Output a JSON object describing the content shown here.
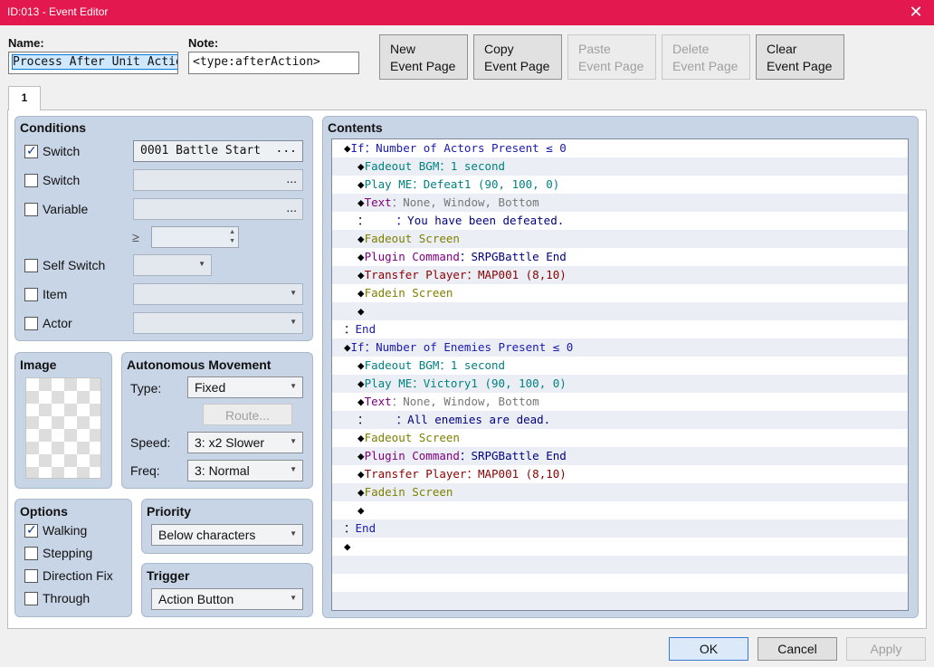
{
  "window": {
    "title": "ID:013 - Event Editor",
    "close_glyph": "✕"
  },
  "header": {
    "name_label": "Name:",
    "name_value": "Process After Unit Action",
    "note_label": "Note:",
    "note_value": "<type:afterAction>",
    "buttons": [
      {
        "line1": "New",
        "line2": "Event Page",
        "enabled": true
      },
      {
        "line1": "Copy",
        "line2": "Event Page",
        "enabled": true
      },
      {
        "line1": "Paste",
        "line2": "Event Page",
        "enabled": false
      },
      {
        "line1": "Delete",
        "line2": "Event Page",
        "enabled": false
      },
      {
        "line1": "Clear",
        "line2": "Event Page",
        "enabled": true
      }
    ]
  },
  "tabs": [
    {
      "label": "1"
    }
  ],
  "conditions": {
    "title": "Conditions",
    "switch1": {
      "label": "Switch",
      "checked": true,
      "value": "0001 Battle Start",
      "dots": "..."
    },
    "switch2": {
      "label": "Switch",
      "checked": false,
      "value": "",
      "dots": "..."
    },
    "variable": {
      "label": "Variable",
      "checked": false,
      "value": "",
      "dots": "...",
      "op": "≥",
      "amount": ""
    },
    "self_switch": {
      "label": "Self Switch",
      "checked": false,
      "value": ""
    },
    "item": {
      "label": "Item",
      "checked": false,
      "value": ""
    },
    "actor": {
      "label": "Actor",
      "checked": false,
      "value": ""
    }
  },
  "image": {
    "title": "Image"
  },
  "autonomous": {
    "title": "Autonomous Movement",
    "type_label": "Type:",
    "type_value": "Fixed",
    "route_button": "Route...",
    "speed_label": "Speed:",
    "speed_value": "3: x2 Slower",
    "freq_label": "Freq:",
    "freq_value": "3: Normal"
  },
  "options": {
    "title": "Options",
    "items": [
      {
        "label": "Walking",
        "checked": true
      },
      {
        "label": "Stepping",
        "checked": false
      },
      {
        "label": "Direction Fix",
        "checked": false
      },
      {
        "label": "Through",
        "checked": false
      }
    ]
  },
  "priority": {
    "title": "Priority",
    "value": "Below characters"
  },
  "trigger": {
    "title": "Trigger",
    "value": "Action Button"
  },
  "contents": {
    "title": "Contents",
    "lines": [
      [
        [
          "◆",
          "black"
        ],
        [
          "If",
          "blue"
        ],
        [
          "：Number of Actors Present ≤ 0",
          "blue"
        ]
      ],
      [
        [
          "  ◆",
          "black"
        ],
        [
          "Fadeout BGM：1 second",
          "teal"
        ]
      ],
      [
        [
          "  ◆",
          "black"
        ],
        [
          "Play ME：Defeat1 (90, 100, 0)",
          "teal"
        ]
      ],
      [
        [
          "  ◆",
          "black"
        ],
        [
          "Text",
          "purple"
        ],
        [
          "：None, Window, Bottom",
          "gray"
        ]
      ],
      [
        [
          "  ：",
          "black"
        ],
        [
          "    ：You have been defeated.",
          "navy"
        ]
      ],
      [
        [
          "  ◆",
          "black"
        ],
        [
          "Fadeout Screen",
          "olive"
        ]
      ],
      [
        [
          "  ◆",
          "black"
        ],
        [
          "Plugin Command",
          "purple"
        ],
        [
          "：SRPGBattle End",
          "navy"
        ]
      ],
      [
        [
          "  ◆",
          "black"
        ],
        [
          "Transfer Player：MAP001 (8,10)",
          "maroon"
        ]
      ],
      [
        [
          "  ◆",
          "black"
        ],
        [
          "Fadein Screen",
          "olive"
        ]
      ],
      [
        [
          "  ◆",
          "black"
        ]
      ],
      [
        [
          "：",
          "black"
        ],
        [
          "End",
          "blue"
        ]
      ],
      [
        [
          "◆",
          "black"
        ],
        [
          "If",
          "blue"
        ],
        [
          "：Number of Enemies Present ≤ 0",
          "blue"
        ]
      ],
      [
        [
          "  ◆",
          "black"
        ],
        [
          "Fadeout BGM：1 second",
          "teal"
        ]
      ],
      [
        [
          "  ◆",
          "black"
        ],
        [
          "Play ME：Victory1 (90, 100, 0)",
          "teal"
        ]
      ],
      [
        [
          "  ◆",
          "black"
        ],
        [
          "Text",
          "purple"
        ],
        [
          "：None, Window, Bottom",
          "gray"
        ]
      ],
      [
        [
          "  ：",
          "black"
        ],
        [
          "    ：All enemies are dead.",
          "navy"
        ]
      ],
      [
        [
          "  ◆",
          "black"
        ],
        [
          "Fadeout Screen",
          "olive"
        ]
      ],
      [
        [
          "  ◆",
          "black"
        ],
        [
          "Plugin Command",
          "purple"
        ],
        [
          "：SRPGBattle End",
          "navy"
        ]
      ],
      [
        [
          "  ◆",
          "black"
        ],
        [
          "Transfer Player：MAP001 (8,10)",
          "maroon"
        ]
      ],
      [
        [
          "  ◆",
          "black"
        ],
        [
          "Fadein Screen",
          "olive"
        ]
      ],
      [
        [
          "  ◆",
          "black"
        ]
      ],
      [
        [
          "：",
          "black"
        ],
        [
          "End",
          "blue"
        ]
      ],
      [
        [
          "◆",
          "black"
        ]
      ],
      [],
      [],
      []
    ]
  },
  "footer": {
    "ok": "OK",
    "cancel": "Cancel",
    "apply": "Apply"
  },
  "colors": {
    "titlebar": "#e2184e",
    "panel": "#c8d5e6",
    "accent": "#0078d7"
  }
}
